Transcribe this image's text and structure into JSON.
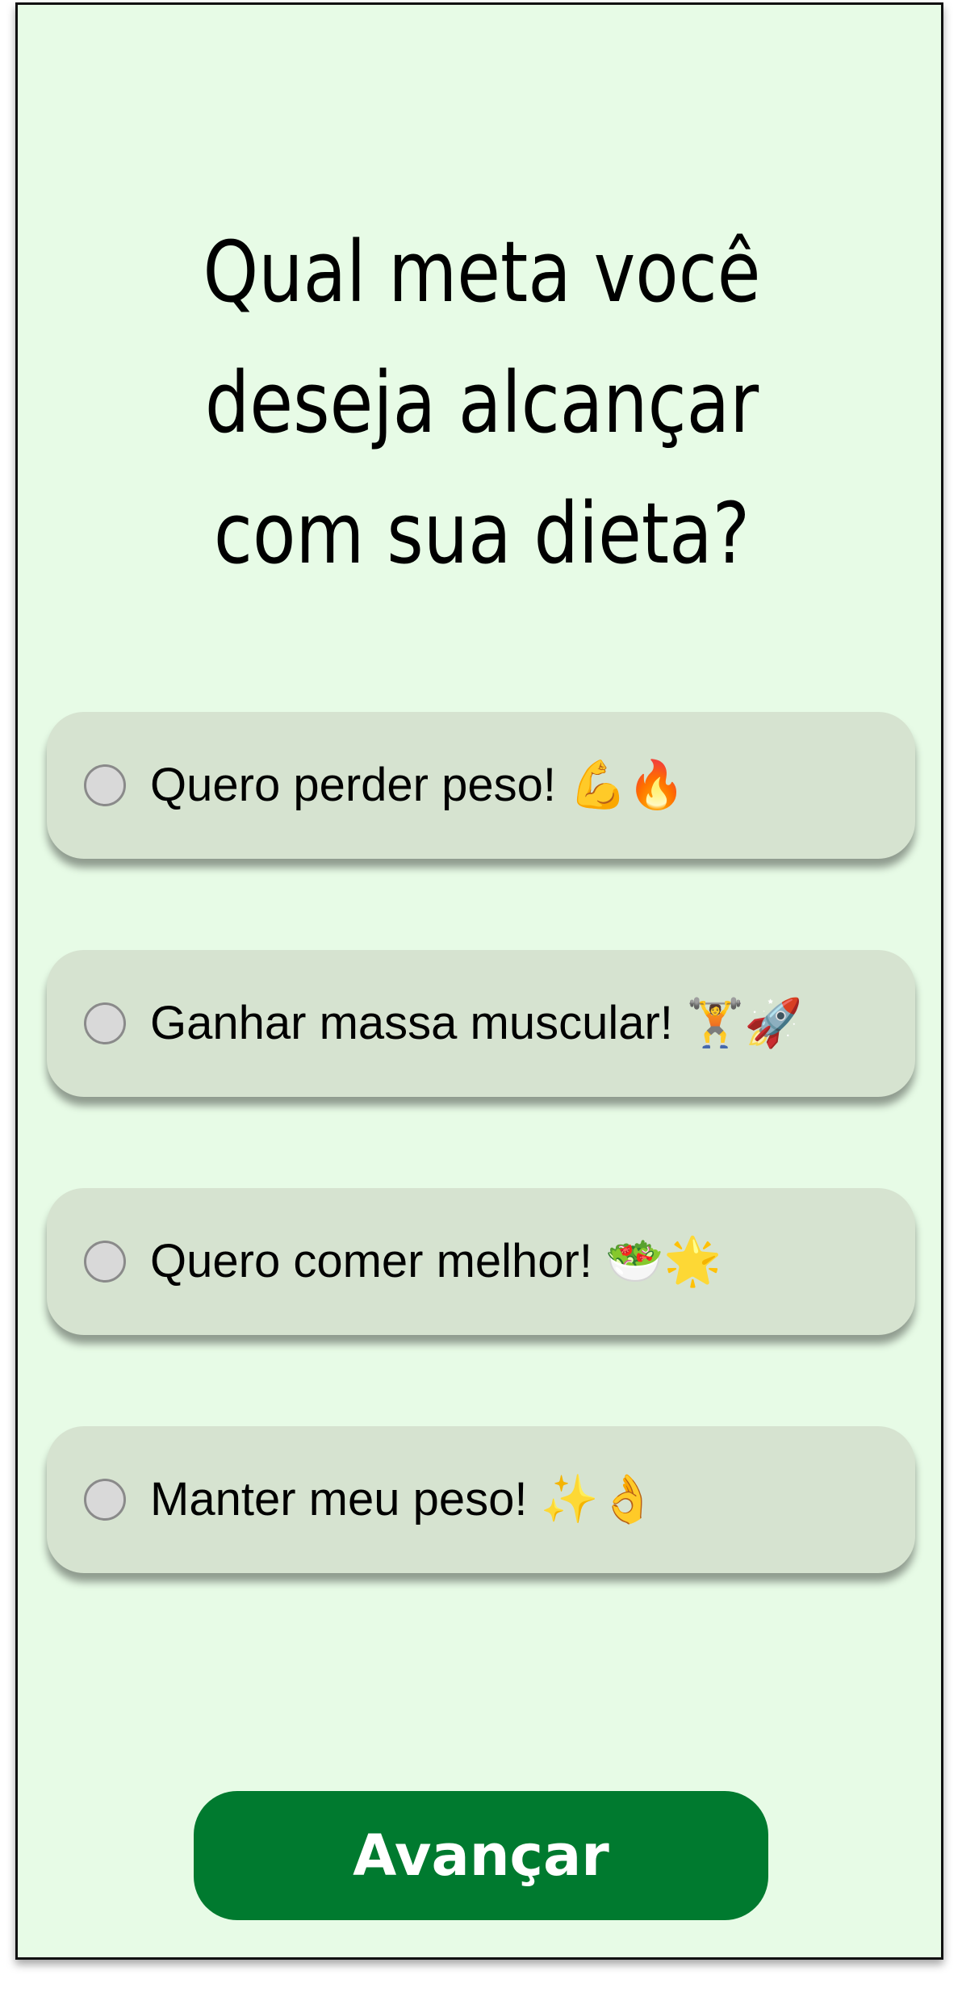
{
  "question": {
    "title": "Qual meta você deseja alcançar com sua dieta?"
  },
  "options": [
    {
      "label": "Quero perder peso! 💪🔥"
    },
    {
      "label": "Ganhar massa muscular! 🏋️🚀"
    },
    {
      "label": "Quero comer melhor! 🥗🌟"
    },
    {
      "label": "Manter meu peso! ✨👌"
    }
  ],
  "actions": {
    "next_label": "Avançar"
  },
  "colors": {
    "background": "#e7fbe6",
    "option_background": "#d6e3d0",
    "primary_button": "#007a2f"
  }
}
